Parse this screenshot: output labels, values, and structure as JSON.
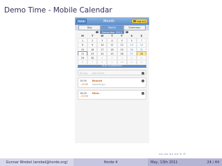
{
  "slide": {
    "title": "Demo Time - Mobile Calendar"
  },
  "app": {
    "prefs_label": "Prefs",
    "title": "Month",
    "logout_label": "Log out",
    "tabs": [
      {
        "label": "Day",
        "active": false
      },
      {
        "label": "Month",
        "active": true
      },
      {
        "label": "Summary",
        "active": false
      }
    ],
    "month_label": "November 2010",
    "prev_label": "‹",
    "next_label": "›",
    "weekdays": [
      "M",
      "T",
      "W",
      "T",
      "F",
      "S",
      "S"
    ],
    "weeks": [
      [
        {
          "d": "1"
        },
        {
          "d": "2"
        },
        {
          "d": "3"
        },
        {
          "d": "4"
        },
        {
          "d": "5"
        },
        {
          "d": "6",
          "w": true
        },
        {
          "d": "7",
          "w": true
        }
      ],
      [
        {
          "d": "8"
        },
        {
          "d": "9"
        },
        {
          "d": "10"
        },
        {
          "d": "11"
        },
        {
          "d": "12"
        },
        {
          "d": "13",
          "w": true
        },
        {
          "d": "14",
          "w": true
        }
      ],
      [
        {
          "d": "15"
        },
        {
          "d": "16"
        },
        {
          "d": "17"
        },
        {
          "d": "18"
        },
        {
          "d": "19"
        },
        {
          "d": "20",
          "w": true
        },
        {
          "d": "21",
          "w": true
        }
      ],
      [
        {
          "d": "22",
          "today": true
        },
        {
          "d": "23"
        },
        {
          "d": "24"
        },
        {
          "d": "25"
        },
        {
          "d": "26"
        },
        {
          "d": "27",
          "w": true
        },
        {
          "d": "28",
          "sel": true
        }
      ],
      [
        {
          "d": "29"
        },
        {
          "d": "30"
        },
        {
          "d": "1",
          "o": true
        },
        {
          "d": "2",
          "o": true
        },
        {
          "d": "3",
          "o": true
        },
        {
          "d": "4",
          "o": true
        },
        {
          "d": "5",
          "o": true
        }
      ],
      [
        {
          "d": "6",
          "o": true
        },
        {
          "d": "7",
          "o": true
        },
        {
          "d": "8",
          "o": true
        },
        {
          "d": "9",
          "o": true
        },
        {
          "d": "10",
          "o": true
        },
        {
          "d": "11",
          "o": true
        },
        {
          "d": "12",
          "o": true
        }
      ]
    ],
    "selected_date": "Sun 11/28/2010",
    "events": [
      {
        "type": "empty",
        "start": "All day",
        "title": "Add Event"
      },
      {
        "type": "event",
        "start": "10:00",
        "end": "- 14:00",
        "title": "Brunch",
        "subtitle": "Jawashingen"
      },
      {
        "type": "event",
        "start": "18:00",
        "end": "- 20:00",
        "title": "Dinn..",
        "subtitle": ""
      }
    ]
  },
  "nav_glyphs": "◂ ▸ ◂ ▸ ◂ ▸ ◂ ▸ ≡ ⟲",
  "footer": {
    "author": "Gunnar Wrobel (wrobel@horde.org)",
    "talk": "Horde 4",
    "date": "May, 13th 2011",
    "page": "24 / 44"
  },
  "colors": {
    "accent": "#5d8cc8",
    "event_title": "#c26016",
    "logout": "#f1d25a",
    "footer_text": "#2f2f57"
  }
}
